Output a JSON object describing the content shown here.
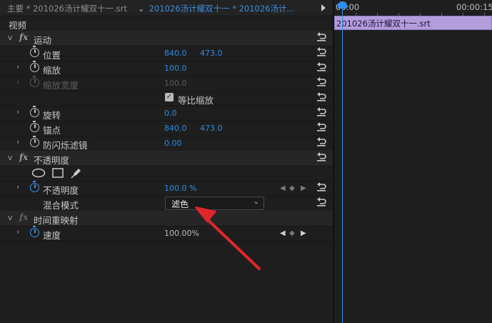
{
  "tabs": {
    "master": "主要 * 201026汤计耀双十一.srt",
    "clip_chevron": "⌄",
    "clip": "201026汤计耀双十一 * 201026汤计..."
  },
  "panel": {
    "video_header": "视频",
    "motion": {
      "name": "运动",
      "position": {
        "label": "位置",
        "x": "840.0",
        "y": "473.0"
      },
      "scale": {
        "label": "缩放",
        "value": "100.0"
      },
      "scale_width": {
        "label": "缩放宽度",
        "value": "100.0"
      },
      "uniform_scale": {
        "label": "等比缩放",
        "checked": true
      },
      "rotation": {
        "label": "旋转",
        "value": "0.0"
      },
      "anchor": {
        "label": "锚点",
        "x": "840.0",
        "y": "473.0"
      },
      "antiflicker": {
        "label": "防闪烁滤镜",
        "value": "0.00"
      }
    },
    "opacity": {
      "name": "不透明度",
      "opacity": {
        "label": "不透明度",
        "value": "100.0 %"
      },
      "blend_mode": {
        "label": "混合模式",
        "value": "滤色"
      }
    },
    "time_remap": {
      "name": "时间重映射",
      "speed": {
        "label": "速度",
        "value": "100.00%"
      }
    }
  },
  "timeline": {
    "tc_start": "00:00",
    "tc_mid": "00:00:15",
    "clip_label": "201026汤计耀双十一.srt",
    "clip_color": "#b39ddb",
    "playhead_color": "#2d8ff0"
  },
  "annotation": {
    "arrow_color": "#e0262b"
  },
  "icons": [
    "stopwatch-icon",
    "reset-icon",
    "ellipse-mask-icon",
    "rect-mask-icon",
    "pen-mask-icon",
    "keyframe-icon",
    "play-icon"
  ]
}
